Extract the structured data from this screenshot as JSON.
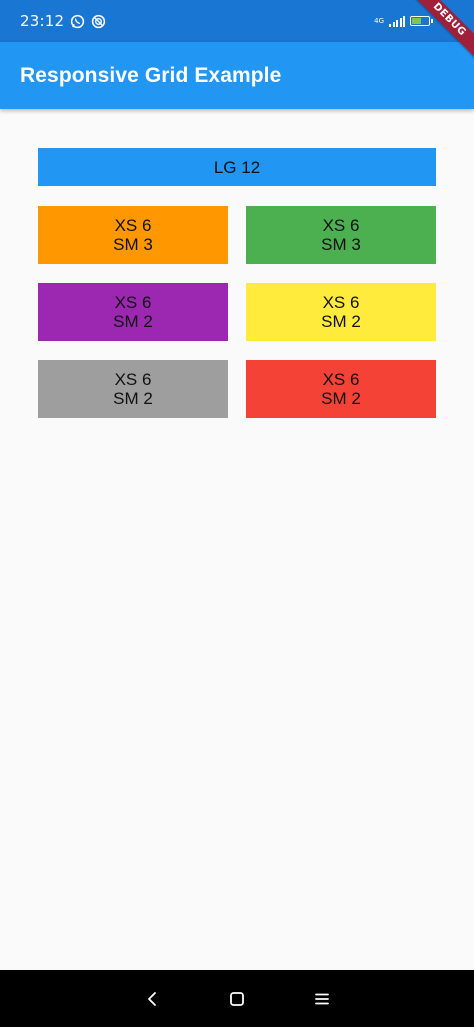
{
  "status_bar": {
    "time": "23:12",
    "network_type": "4G",
    "left_icons": [
      "whatsapp-icon",
      "sync-icon"
    ],
    "right_icons": [
      "signal-icon",
      "battery-icon"
    ]
  },
  "debug_banner": {
    "label": "DEBUG"
  },
  "app_bar": {
    "title": "Responsive Grid Example",
    "color": "#2196f3"
  },
  "grid": {
    "header_cell": {
      "label": "LG 12",
      "color": "#2196f3"
    },
    "cells": [
      {
        "line1": "XS 6",
        "line2": "SM 3",
        "color": "#ff9800"
      },
      {
        "line1": "XS 6",
        "line2": "SM 3",
        "color": "#4caf50"
      },
      {
        "line1": "XS 6",
        "line2": "SM 2",
        "color": "#9c27b0"
      },
      {
        "line1": "XS 6",
        "line2": "SM 2",
        "color": "#ffeb3b"
      },
      {
        "line1": "XS 6",
        "line2": "SM 2",
        "color": "#9e9e9e"
      },
      {
        "line1": "XS 6",
        "line2": "SM 2",
        "color": "#f44336"
      }
    ]
  },
  "nav_bar": {
    "buttons": [
      "back-icon",
      "home-icon",
      "menu-icon"
    ]
  }
}
